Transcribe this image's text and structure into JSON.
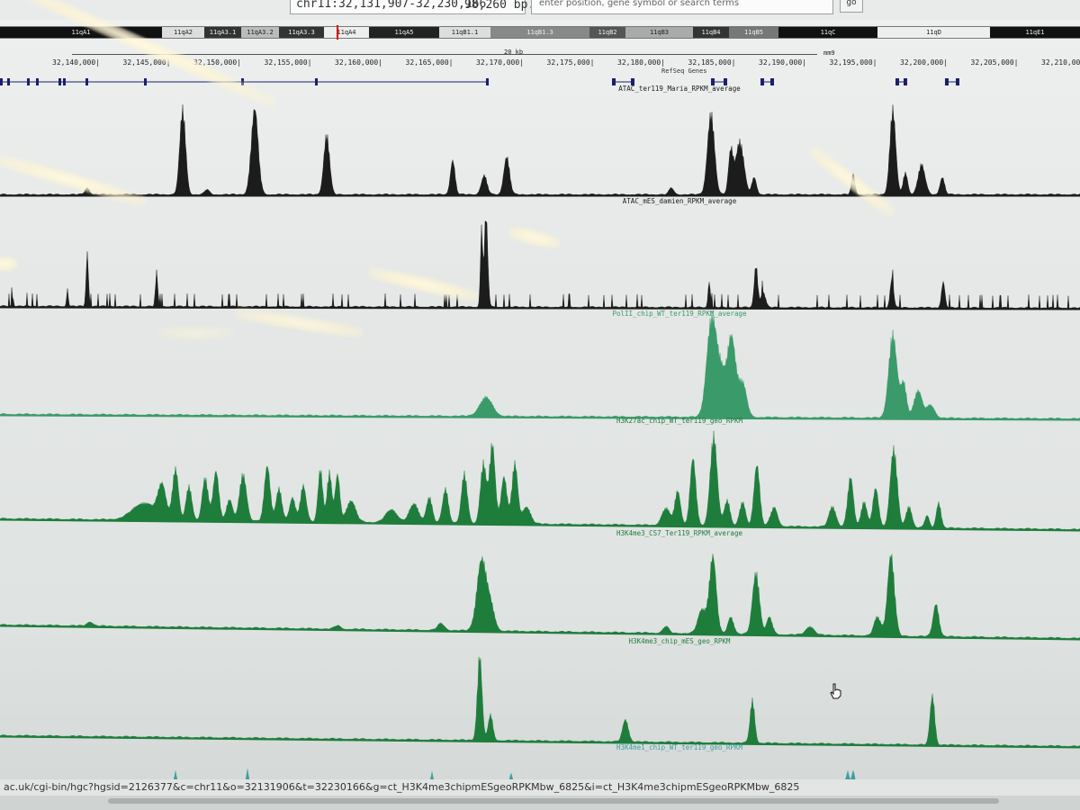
{
  "header": {
    "position": "chr11:32,131,907-32,230,166",
    "bp": "98,260 bp.",
    "search_placeholder": "enter position, gene symbol or search terms",
    "go_label": "go"
  },
  "ideogram": {
    "bands": [
      "11qA1",
      "11qA2",
      "11qA3.1",
      "11qA3.2",
      "11qA3.3",
      "11qA4",
      "11qA5",
      "11qB1.1",
      "11qB1.3",
      "11qB2",
      "11qB3",
      "11qB4",
      "11qB5",
      "11qC",
      "11qD",
      "11qE1"
    ],
    "first_band_partial": "11qA1"
  },
  "ruler": {
    "scale": "20 kb",
    "assembly": "mm9",
    "ticks": [
      "32,140,000|",
      "32,145,000|",
      "32,150,000|",
      "32,155,000|",
      "32,160,000|",
      "32,165,000|",
      "32,170,000|",
      "32,175,000|",
      "32,180,000|",
      "32,185,000|",
      "32,190,000|",
      "32,195,000|",
      "32,200,000|",
      "32,205,000|",
      "32,210,000"
    ]
  },
  "refseq_label": "RefSeq Genes",
  "tracks": [
    {
      "label": "ATAC_ter119_Maria_RPKM_average",
      "color": "#1c1c1c"
    },
    {
      "label": "ATAC_mES_damien_RPKM_average",
      "color": "#1c1c1c"
    },
    {
      "label": "PolII_chip_WT_ter119_RPKM_average",
      "color": "#3a9a6a"
    },
    {
      "label": "H3K27ac_chip_WT_ter119_geo_RPKM",
      "color": "#1f7d3c"
    },
    {
      "label": "H3K4me3_CS7_Ter119_RPKM_average",
      "color": "#1f7d3c"
    },
    {
      "label": "H3K4me3_chip_mES_geo_RPKM",
      "color": "#1f7d3c"
    },
    {
      "label": "H3K4me1_chip_WT_ter119_geo_RPKM",
      "color": "#3aa0a0"
    }
  ],
  "status_url": "ac.uk/cgi-bin/hgc?hgsid=2126377&c=chr11&o=32131906&t=32230166&g=ct_H3K4me3chipmESgeoRPKMbw_6825&i=ct_H3K4me3chipmESgeoRPKMbw_6825",
  "cursor": "hand-pointer-icon"
}
